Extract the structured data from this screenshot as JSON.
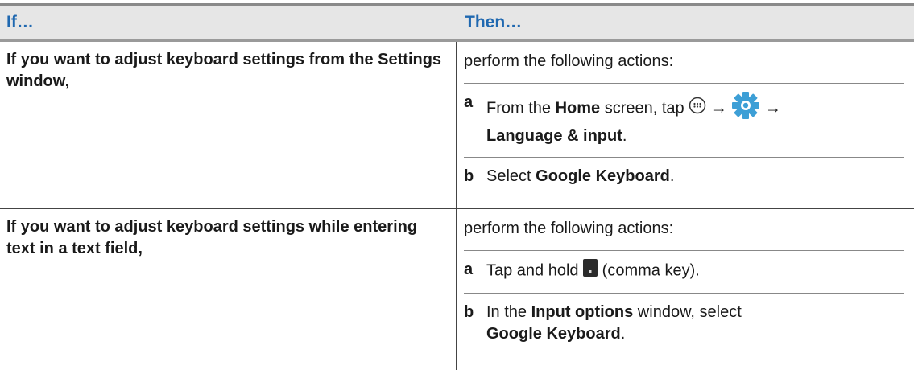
{
  "header": {
    "if": "If…",
    "then": "Then…"
  },
  "rows": [
    {
      "condition": "If you want to adjust keyboard settings from the Settings window,",
      "intro": "perform the following actions:",
      "steps": [
        {
          "label": "a",
          "from": "From the ",
          "home": "Home",
          "screen_tap": " screen, tap ",
          "arrow1": " → ",
          "arrow2": " →",
          "language": "Language & input",
          "period": ".",
          "icons": [
            "apps-icon",
            "settings-gear-icon"
          ]
        },
        {
          "label": "b",
          "select": "Select ",
          "google_keyboard": "Google Keyboard",
          "period": "."
        }
      ]
    },
    {
      "condition": "If you want to adjust keyboard settings while entering text in a text field,",
      "intro": "perform the following actions:",
      "steps": [
        {
          "label": "a",
          "tap_hold": "Tap and hold ",
          "comma": " (comma key).",
          "icons": [
            "comma-key-icon"
          ]
        },
        {
          "label": "b",
          "in_the": "In the ",
          "input_options": "Input options",
          "window_select": " window, select",
          "google_keyboard": "Google Keyboard",
          "period": "."
        }
      ]
    }
  ],
  "colors": {
    "header_text": "#1f68b0",
    "header_bg": "#e6e6e6",
    "gear": "#3d9fd6"
  }
}
